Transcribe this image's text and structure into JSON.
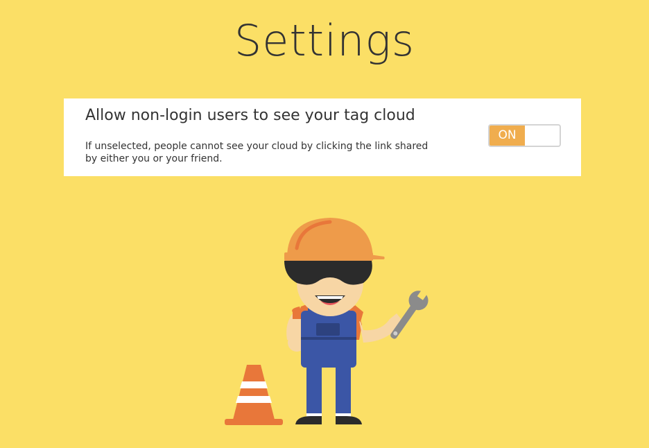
{
  "page": {
    "title": "Settings"
  },
  "settings": [
    {
      "title": "Allow non-login users to see your tag cloud",
      "description": "If unselected, people cannot see your cloud by clicking the link shared by either you or your friend.",
      "toggle": {
        "state_label": "ON",
        "checked": true
      }
    }
  ],
  "illustration": {
    "subject": "construction-worker-with-wrench",
    "props": [
      "traffic-cone-icon",
      "wrench-icon"
    ]
  },
  "colors": {
    "background": "#fbdf66",
    "card": "#ffffff",
    "accent": "#f0ad4e",
    "text": "#333333"
  }
}
